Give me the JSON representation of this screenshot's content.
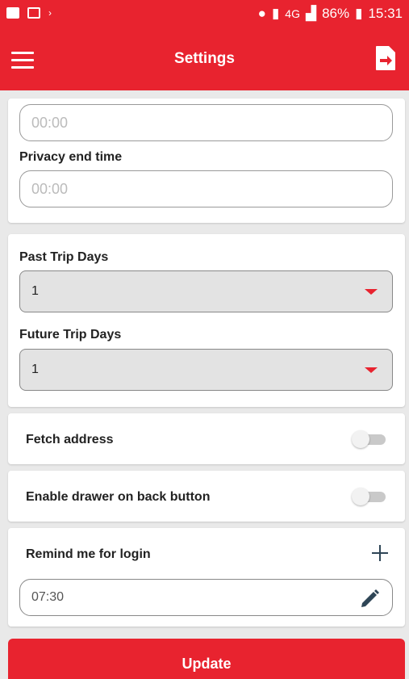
{
  "status_bar": {
    "network": "4G",
    "battery": "86%",
    "time": "15:31"
  },
  "app_bar": {
    "title": "Settings",
    "menu_icon": "hamburger-menu-icon",
    "logout_icon": "logout-icon"
  },
  "privacy": {
    "start_time_placeholder": "00:00",
    "end_time_label": "Privacy end time",
    "end_time_placeholder": "00:00"
  },
  "trips": {
    "past_label": "Past Trip Days",
    "past_value": "1",
    "future_label": "Future Trip Days",
    "future_value": "1"
  },
  "fetch_address": {
    "label": "Fetch address",
    "enabled": false
  },
  "drawer_back": {
    "label": "Enable drawer on back button",
    "enabled": false
  },
  "login_reminder": {
    "label": "Remind me for login",
    "time": "07:30",
    "add_icon": "plus-icon",
    "edit_icon": "pencil-icon"
  },
  "update_button": {
    "label": "Update"
  },
  "colors": {
    "accent": "#e8232f",
    "background": "#e9e9e9"
  }
}
